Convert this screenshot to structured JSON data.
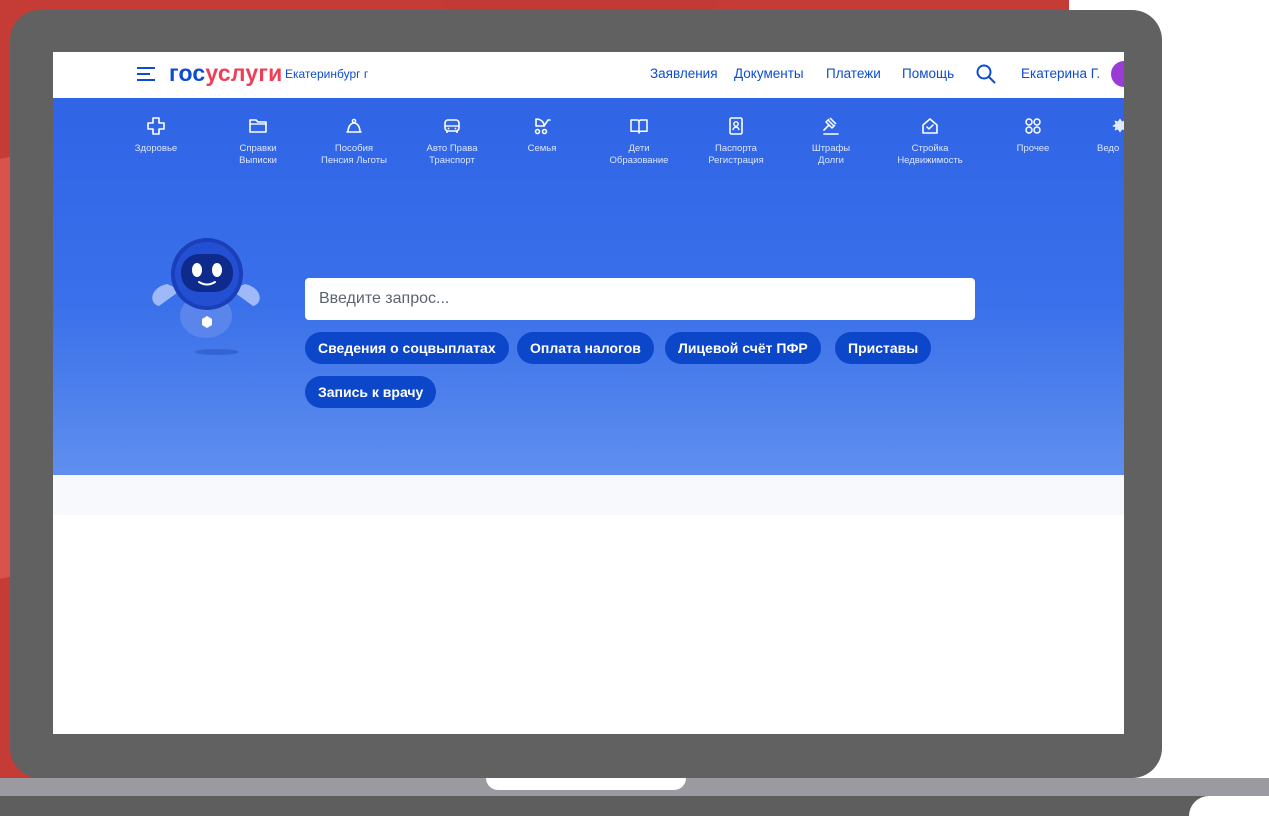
{
  "header": {
    "logo_part1": "гос",
    "logo_part2": "услуги",
    "city": "Екатеринбург г",
    "nav": [
      {
        "label": "Заявления"
      },
      {
        "label": "Документы"
      },
      {
        "label": "Платежи"
      },
      {
        "label": "Помощь"
      }
    ],
    "user_name": "Екатерина Г."
  },
  "categories": [
    {
      "line1": "Здоровье",
      "line2": ""
    },
    {
      "line1": "Справки",
      "line2": "Выписки"
    },
    {
      "line1": "Пособия",
      "line2": "Пенсия Льготы"
    },
    {
      "line1": "Авто Права",
      "line2": "Транспорт"
    },
    {
      "line1": "Семья",
      "line2": ""
    },
    {
      "line1": "Дети",
      "line2": "Образование"
    },
    {
      "line1": "Паспорта",
      "line2": "Регистрация"
    },
    {
      "line1": "Штрафы",
      "line2": "Долги"
    },
    {
      "line1": "Стройка",
      "line2": "Недвижимость"
    },
    {
      "line1": "Прочее",
      "line2": ""
    },
    {
      "line1": "Ведо",
      "line2": ""
    }
  ],
  "search": {
    "placeholder": "Введите запрос...",
    "value": ""
  },
  "quick_links": [
    {
      "label": "Сведения о соцвыплатах"
    },
    {
      "label": "Оплата налогов"
    },
    {
      "label": "Лицевой счёт ПФР"
    },
    {
      "label": "Приставы"
    },
    {
      "label": "Запись к врачу"
    }
  ],
  "colors": {
    "brand_blue": "#0d4cd3",
    "brand_red": "#ee3f58",
    "hero_blue": "#3a70ea",
    "chip_blue": "#0d47c9",
    "avatar": "#9b3bd6"
  },
  "icons": [
    "menu-icon",
    "search-icon",
    "health-icon",
    "folder-icon",
    "bell-icon",
    "car-icon",
    "stroller-icon",
    "book-icon",
    "passport-icon",
    "gavel-icon",
    "house-icon",
    "grid-icon",
    "emblem-icon"
  ]
}
